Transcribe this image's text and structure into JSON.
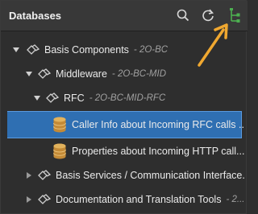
{
  "header": {
    "title": "Databases",
    "icons": [
      "search-icon",
      "refresh-icon",
      "tree-link-icon"
    ]
  },
  "tree": {
    "rows": [
      {
        "label": "Basis Components",
        "suffix": "- 2O-BC",
        "icon": "component-icon",
        "expanded": true
      },
      {
        "label": "Middleware",
        "suffix": "- 2O-BC-MID",
        "icon": "component-icon",
        "expanded": true
      },
      {
        "label": "RFC",
        "suffix": "- 2O-BC-MID-RFC",
        "icon": "component-icon",
        "expanded": true
      },
      {
        "label": "Caller Info about Incoming RFC calls ...",
        "suffix": "",
        "icon": "database-icon",
        "selected": true
      },
      {
        "label": "Properties about Incoming HTTP call...",
        "suffix": "",
        "icon": "database-icon"
      },
      {
        "label": "Basis Services / Communication Interface...",
        "suffix": "",
        "icon": "component-icon",
        "expanded": false
      },
      {
        "label": "Documentation and Translation Tools",
        "suffix": "- 2...",
        "icon": "component-icon",
        "expanded": false
      }
    ]
  },
  "colors": {
    "background": "#2e2e2e",
    "header": "#383838",
    "selection": "#2f6fb2",
    "accent_green": "#4caf50",
    "annotation_arrow": "#f0a830",
    "database_icon": "#d9a14a"
  }
}
